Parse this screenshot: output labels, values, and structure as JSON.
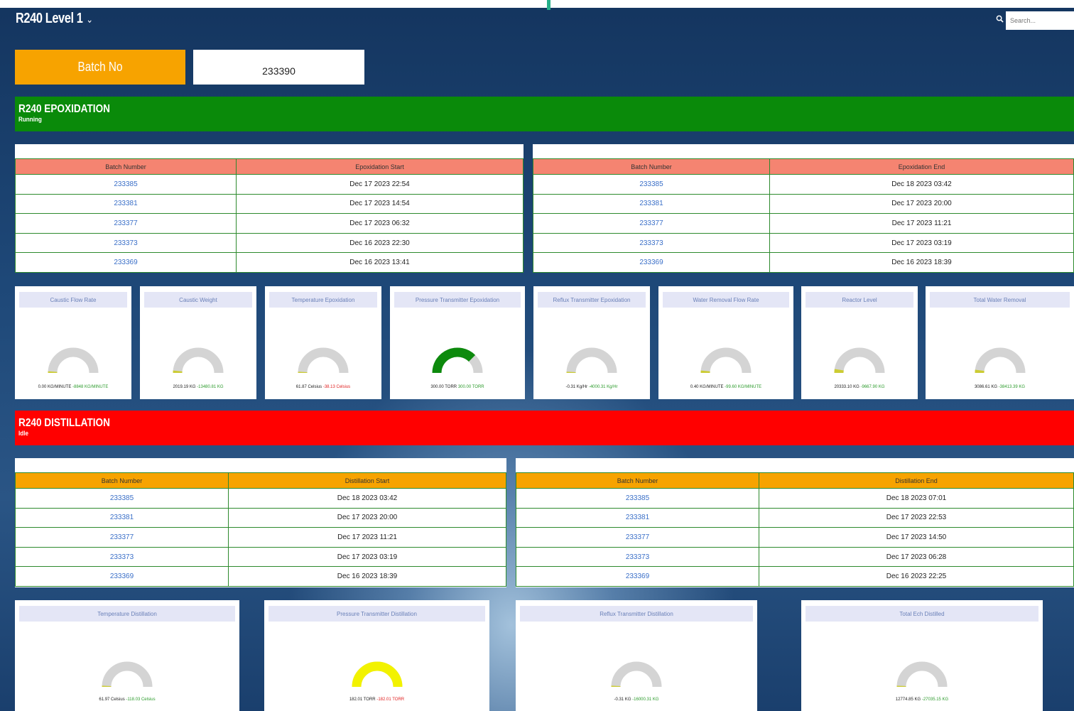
{
  "header": {
    "title": "R240 Level 1",
    "search_placeholder": "Search..."
  },
  "batch": {
    "label": "Batch No",
    "value": "233390"
  },
  "epoxidation": {
    "title": "R240 EPOXIDATION",
    "status": "Running",
    "banner_color": "#0a8a0a",
    "start_table": {
      "headers": [
        "Batch Number",
        "Epoxidation Start"
      ],
      "rows": [
        [
          "233385",
          "Dec 17 2023 22:54"
        ],
        [
          "233381",
          "Dec 17 2023 14:54"
        ],
        [
          "233377",
          "Dec 17 2023 06:32"
        ],
        [
          "233373",
          "Dec 16 2023 22:30"
        ],
        [
          "233369",
          "Dec 16 2023 13:41"
        ]
      ]
    },
    "end_table": {
      "headers": [
        "Batch Number",
        "Epoxidation End"
      ],
      "rows": [
        [
          "233385",
          "Dec 18 2023 03:42"
        ],
        [
          "233381",
          "Dec 17 2023 20:00"
        ],
        [
          "233377",
          "Dec 17 2023 11:21"
        ],
        [
          "233373",
          "Dec 17 2023 03:19"
        ],
        [
          "233369",
          "Dec 16 2023 18:39"
        ]
      ]
    },
    "gauges": [
      {
        "title": "Caustic Flow Rate",
        "value": "0.00 KG/MINUTE",
        "delta": "-8848 KG/MINUTE",
        "delta_color": "green",
        "fill": 0.02,
        "color": "#cccc33"
      },
      {
        "title": "Caustic Weight",
        "value": "2019.19 KG",
        "delta": "-13480.81 KG",
        "delta_color": "green",
        "fill": 0.03,
        "color": "#cccc33"
      },
      {
        "title": "Temperature Epoxidation",
        "value": "61.87 Celsius",
        "delta": "-38.13 Celsius",
        "delta_color": "red",
        "fill": 0.0,
        "color": "#cccc33"
      },
      {
        "title": "Pressure Transmitter Epoxidation",
        "value": "300.00 TORR",
        "delta": "300.00 TORR",
        "delta_color": "green",
        "fill": 0.75,
        "color": "#0d8a0d"
      },
      {
        "title": "Reflux Transmitter Epoxidation",
        "value": "-0.31 Kg/Hr",
        "delta": "-4000.31 Kg/Hr",
        "delta_color": "green",
        "fill": 0.0,
        "color": "#cccc33"
      },
      {
        "title": "Water Removal Flow Rate",
        "value": "0.40 KG/MINUTE",
        "delta": "-99.60 KG/MINUTE",
        "delta_color": "green",
        "fill": 0.03,
        "color": "#cccc33"
      },
      {
        "title": "Reactor Level",
        "value": "20333.10 KG",
        "delta": "-9667.90 KG",
        "delta_color": "green",
        "fill": 0.05,
        "color": "#cccc33"
      },
      {
        "title": "Total Water Removal",
        "value": "3086.61 KG",
        "delta": "-38413.39 KG",
        "delta_color": "green",
        "fill": 0.04,
        "color": "#cccc33"
      }
    ]
  },
  "distillation": {
    "title": "R240 DISTILLATION",
    "status": "Idle",
    "banner_color": "#ff0000",
    "start_table": {
      "headers": [
        "Batch Number",
        "Distillation Start"
      ],
      "rows": [
        [
          "233385",
          "Dec 18 2023 03:42"
        ],
        [
          "233381",
          "Dec 17 2023 20:00"
        ],
        [
          "233377",
          "Dec 17 2023 11:21"
        ],
        [
          "233373",
          "Dec 17 2023 03:19"
        ],
        [
          "233369",
          "Dec 16 2023 18:39"
        ]
      ]
    },
    "end_table": {
      "headers": [
        "Batch Number",
        "Distillation End"
      ],
      "rows": [
        [
          "233385",
          "Dec 18 2023 07:01"
        ],
        [
          "233381",
          "Dec 17 2023 22:53"
        ],
        [
          "233377",
          "Dec 17 2023 14:50"
        ],
        [
          "233373",
          "Dec 17 2023 06:28"
        ],
        [
          "233369",
          "Dec 16 2023 22:25"
        ]
      ]
    },
    "gauges": [
      {
        "title": "Temperature Distillation",
        "value": "61.97 Celsius",
        "delta": "-118.03 Celsius",
        "delta_color": "green",
        "fill": 0.0,
        "color": "#cccc33"
      },
      {
        "title": "Pressure Transmitter Distillation",
        "value": "182.01 TORR",
        "delta": "-182.01 TORR",
        "delta_color": "red",
        "fill": 1.0,
        "color": "#f2f200"
      },
      {
        "title": "Reflux Transmitter Distillation",
        "value": "-0.31 KG",
        "delta": "-16000.31 KG",
        "delta_color": "green",
        "fill": 0.0,
        "color": "#cccc33"
      },
      {
        "title": "Total Ech Distilled",
        "value": "12774.85 KG",
        "delta": "-27035.15 KG",
        "delta_color": "green",
        "fill": 0.0,
        "color": "#cccc33"
      }
    ]
  }
}
